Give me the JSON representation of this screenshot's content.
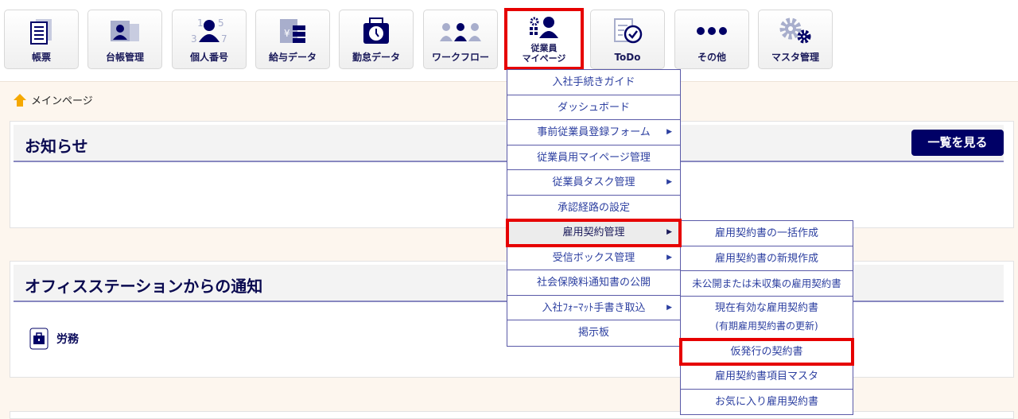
{
  "toolbar": [
    {
      "label": "帳票",
      "icon": "document-icon"
    },
    {
      "label": "台帳管理",
      "icon": "id-card-icon"
    },
    {
      "label": "個人番号",
      "icon": "person-number-icon"
    },
    {
      "label": "給与データ",
      "icon": "salary-icon"
    },
    {
      "label": "勤怠データ",
      "icon": "timecard-icon"
    },
    {
      "label": "ワークフロー",
      "icon": "workflow-icon"
    },
    {
      "label_line1": "従業員",
      "label_line2": "マイページ",
      "icon": "employee-mypage-icon"
    },
    {
      "label": "ToDo",
      "icon": "todo-icon"
    },
    {
      "label": "その他",
      "icon": "more-icon"
    },
    {
      "label": "マスタ管理",
      "icon": "gear-icon"
    }
  ],
  "breadcrumb": {
    "label": "メインページ"
  },
  "notice": {
    "title": "お知らせ",
    "more_button": "一覧を見る"
  },
  "office": {
    "title": "オフィスステーションからの通知",
    "item": "労務"
  },
  "menu": [
    {
      "label": "入社手続きガイド"
    },
    {
      "label": "ダッシュボード"
    },
    {
      "label": "事前従業員登録フォーム",
      "sub": true
    },
    {
      "label": "従業員用マイページ管理"
    },
    {
      "label": "従業員タスク管理",
      "sub": true
    },
    {
      "label": "承認経路の設定"
    },
    {
      "label": "雇用契約管理",
      "sub": true
    },
    {
      "label": "受信ボックス管理",
      "sub": true
    },
    {
      "label": "社会保険料通知書の公開"
    },
    {
      "label": "入社ﾌｫｰﾏｯﾄ手書き取込",
      "sub": true
    },
    {
      "label": "掲示板"
    }
  ],
  "submenu": [
    {
      "label": "雇用契約書の一括作成"
    },
    {
      "label": "雇用契約書の新規作成"
    },
    {
      "label": "未公開または未収集の雇用契約書"
    },
    {
      "label": "現在有効な雇用契約書",
      "note": "(有期雇用契約書の更新)"
    },
    {
      "label": "仮発行の契約書"
    },
    {
      "label": "雇用契約書項目マスタ"
    },
    {
      "label": "お気に入り雇用契約書"
    }
  ],
  "colors": {
    "navy": "#000066",
    "highlight": "#e60000",
    "bg": "#fdf6ee"
  }
}
